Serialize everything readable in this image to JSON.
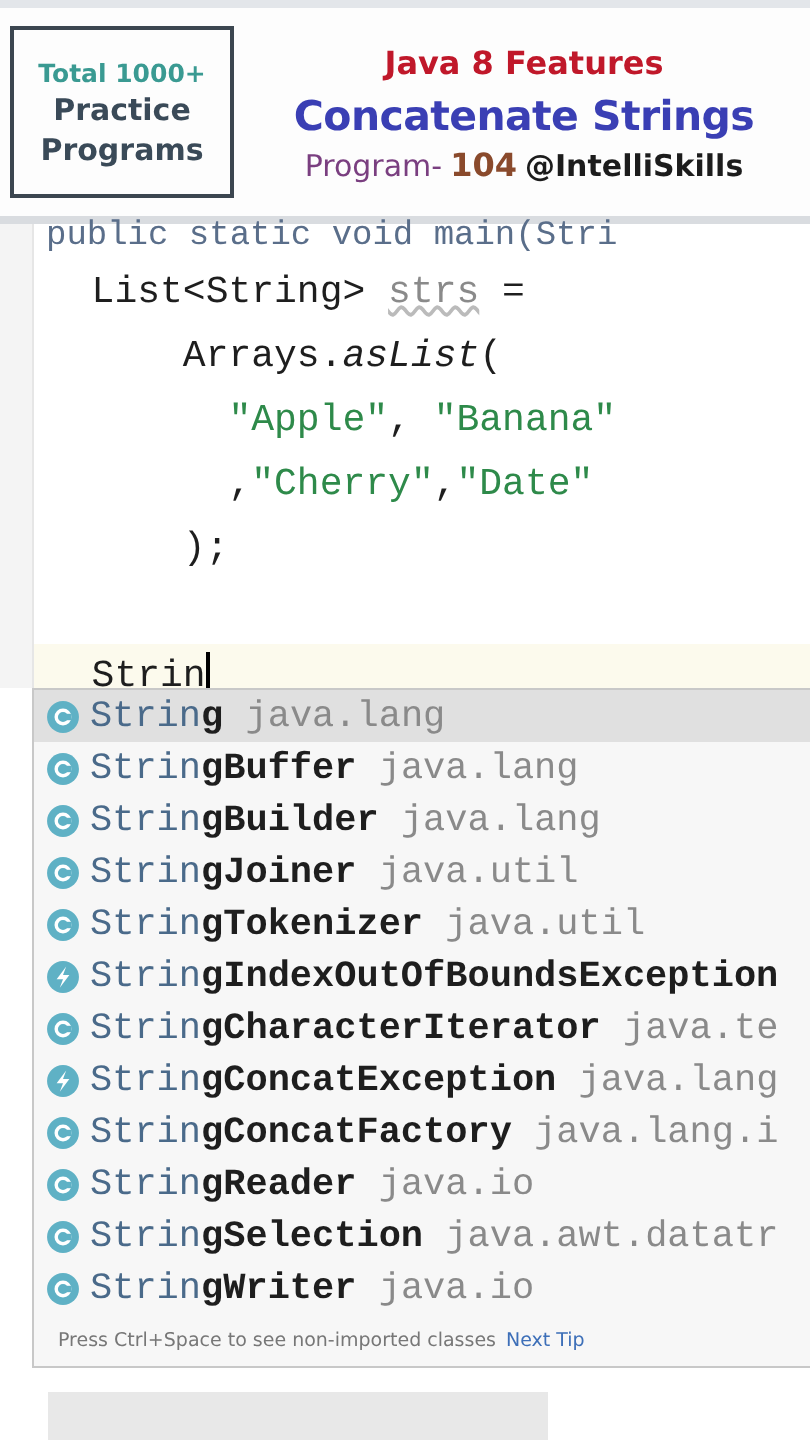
{
  "banner": {
    "badge": [
      "Total 1000+",
      "Practice",
      "Programs"
    ],
    "topic": "Java 8 Features",
    "title": "Concatenate Strings",
    "program_label": "Program-",
    "program_number": "104",
    "handle": "@IntelliSkills"
  },
  "editor": {
    "lines": [
      {
        "current": false,
        "segments": [
          {
            "text": "public static void main(Stri",
            "kind": "faded"
          }
        ]
      },
      {
        "current": false,
        "segments": [
          {
            "text": "  List<String> ",
            "kind": "plain"
          },
          {
            "text": "strs",
            "kind": "unused"
          },
          {
            "text": " =",
            "kind": "plain"
          }
        ]
      },
      {
        "current": false,
        "segments": [
          {
            "text": "      Arrays.",
            "kind": "plain"
          },
          {
            "text": "asList",
            "kind": "static"
          },
          {
            "text": "(",
            "kind": "plain"
          }
        ]
      },
      {
        "current": false,
        "segments": [
          {
            "text": "        \"Apple\"",
            "kind": "string"
          },
          {
            "text": ", ",
            "kind": "plain"
          },
          {
            "text": "\"Banana\"",
            "kind": "string"
          }
        ]
      },
      {
        "current": false,
        "segments": [
          {
            "text": "        ,",
            "kind": "plain"
          },
          {
            "text": "\"Cherry\"",
            "kind": "string"
          },
          {
            "text": ",",
            "kind": "plain"
          },
          {
            "text": "\"Date\"",
            "kind": "string"
          }
        ]
      },
      {
        "current": false,
        "segments": [
          {
            "text": "      );",
            "kind": "plain"
          }
        ]
      },
      {
        "current": true,
        "segments": [
          {
            "text": "  Strin",
            "kind": "plain"
          }
        ]
      }
    ]
  },
  "completion": {
    "items": [
      {
        "kind": "class",
        "match": "Strin",
        "rest": "g",
        "package": "java.lang",
        "selected": true
      },
      {
        "kind": "class",
        "match": "Strin",
        "rest": "gBuffer",
        "package": "java.lang",
        "selected": false
      },
      {
        "kind": "class",
        "match": "Strin",
        "rest": "gBuilder",
        "package": "java.lang",
        "selected": false
      },
      {
        "kind": "class",
        "match": "Strin",
        "rest": "gJoiner",
        "package": "java.util",
        "selected": false
      },
      {
        "kind": "class",
        "match": "Strin",
        "rest": "gTokenizer",
        "package": "java.util",
        "selected": false
      },
      {
        "kind": "exception",
        "match": "Strin",
        "rest": "gIndexOutOfBoundsException",
        "selected": false
      },
      {
        "kind": "class",
        "match": "Strin",
        "rest": "gCharacterIterator",
        "package": "java.te",
        "selected": false
      },
      {
        "kind": "exception",
        "match": "Strin",
        "rest": "gConcatException",
        "package": "java.lang",
        "selected": false
      },
      {
        "kind": "class",
        "match": "Strin",
        "rest": "gConcatFactory",
        "package": "java.lang.i",
        "selected": false
      },
      {
        "kind": "class",
        "match": "Strin",
        "rest": "gReader",
        "package": "java.io",
        "selected": false
      },
      {
        "kind": "class",
        "match": "Strin",
        "rest": "gSelection",
        "package": "java.awt.datatr",
        "selected": false
      },
      {
        "kind": "class",
        "match": "Strin",
        "rest": "gWriter",
        "package": "java.io",
        "selected": false
      }
    ],
    "hint": "Press Ctrl+Space to see non-imported classes",
    "tip_link": "Next Tip"
  }
}
